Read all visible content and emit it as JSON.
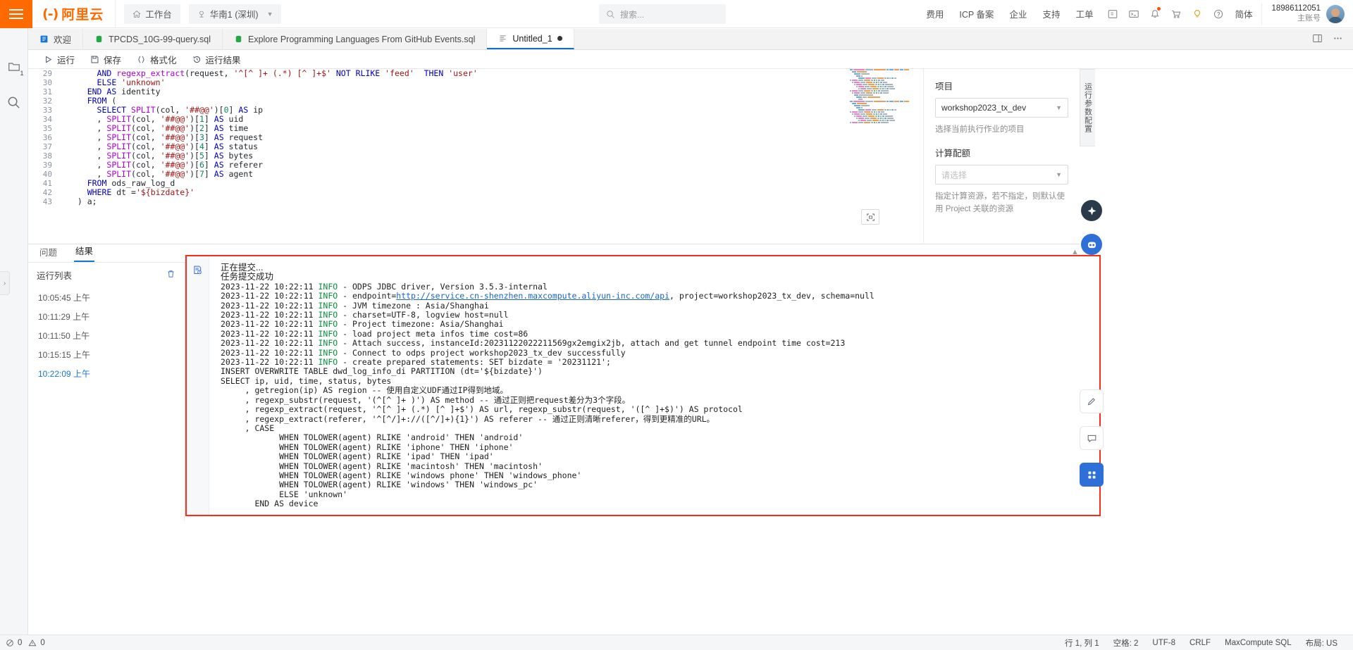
{
  "header": {
    "logo_text": "阿里云",
    "workbench": "工作台",
    "region": "华南1 (深圳)",
    "search_placeholder": "搜索...",
    "links": [
      "费用",
      "ICP 备案",
      "企业",
      "支持",
      "工单"
    ],
    "icons": [
      "app-switch-icon",
      "terminal-icon",
      "bell-icon",
      "cart-icon",
      "bulb-icon",
      "help-icon"
    ],
    "lang": "简体",
    "user_id": "18986112051",
    "user_role": "主账号"
  },
  "left_rail": {
    "items": [
      "folder-icon",
      "search-icon"
    ],
    "folder_badge": "1"
  },
  "tabs": [
    {
      "label": "欢迎",
      "icon": "welcome-icon",
      "active": false,
      "dirty": false
    },
    {
      "label": "TPCDS_10G-99-query.sql",
      "icon": "sql-file-icon",
      "active": false,
      "dirty": false
    },
    {
      "label": "Explore Programming Languages From GitHub Events.sql",
      "icon": "sql-file-icon",
      "active": false,
      "dirty": false
    },
    {
      "label": "Untitled_1",
      "icon": "sql-doc-icon",
      "active": true,
      "dirty": true
    }
  ],
  "toolbar": [
    {
      "label": "运行",
      "icon": "play-icon"
    },
    {
      "label": "保存",
      "icon": "save-icon"
    },
    {
      "label": "格式化",
      "icon": "braces-icon"
    },
    {
      "label": "运行结果",
      "icon": "history-icon"
    }
  ],
  "editor": {
    "zoom_icon": "fit-screen-icon",
    "lines": [
      {
        "no": 29,
        "tokens": [
          {
            "t": "      ",
            "c": "pl"
          },
          {
            "t": "AND",
            "c": "k"
          },
          {
            "t": " ",
            "c": "pl"
          },
          {
            "t": "regexp_extract",
            "c": "kp"
          },
          {
            "t": "(request, ",
            "c": "pl"
          },
          {
            "t": "'^[^ ]+ (.*) [^ ]+$'",
            "c": "s"
          },
          {
            "t": " ",
            "c": "pl"
          },
          {
            "t": "NOT",
            "c": "k"
          },
          {
            "t": " ",
            "c": "pl"
          },
          {
            "t": "RLIKE",
            "c": "k"
          },
          {
            "t": " ",
            "c": "pl"
          },
          {
            "t": "'feed'",
            "c": "s"
          },
          {
            "t": "  ",
            "c": "pl"
          },
          {
            "t": "THEN",
            "c": "k"
          },
          {
            "t": " ",
            "c": "pl"
          },
          {
            "t": "'user'",
            "c": "s"
          }
        ]
      },
      {
        "no": 30,
        "tokens": [
          {
            "t": "      ",
            "c": "pl"
          },
          {
            "t": "ELSE",
            "c": "k"
          },
          {
            "t": " ",
            "c": "pl"
          },
          {
            "t": "'unknown'",
            "c": "s"
          }
        ]
      },
      {
        "no": 31,
        "tokens": [
          {
            "t": "    ",
            "c": "pl"
          },
          {
            "t": "END AS",
            "c": "k"
          },
          {
            "t": " identity",
            "c": "pl"
          }
        ]
      },
      {
        "no": 32,
        "tokens": [
          {
            "t": "    ",
            "c": "pl"
          },
          {
            "t": "FROM",
            "c": "k"
          },
          {
            "t": " (",
            "c": "pl"
          }
        ]
      },
      {
        "no": 33,
        "tokens": [
          {
            "t": "      ",
            "c": "pl"
          },
          {
            "t": "SELECT",
            "c": "k"
          },
          {
            "t": " ",
            "c": "pl"
          },
          {
            "t": "SPLIT",
            "c": "kp"
          },
          {
            "t": "(col, ",
            "c": "pl"
          },
          {
            "t": "'##@@'",
            "c": "s"
          },
          {
            "t": ")[",
            "c": "pl"
          },
          {
            "t": "0",
            "c": "n"
          },
          {
            "t": "] ",
            "c": "pl"
          },
          {
            "t": "AS",
            "c": "k"
          },
          {
            "t": " ip",
            "c": "pl"
          }
        ]
      },
      {
        "no": 34,
        "tokens": [
          {
            "t": "      , ",
            "c": "pl"
          },
          {
            "t": "SPLIT",
            "c": "kp"
          },
          {
            "t": "(col, ",
            "c": "pl"
          },
          {
            "t": "'##@@'",
            "c": "s"
          },
          {
            "t": ")[",
            "c": "pl"
          },
          {
            "t": "1",
            "c": "n"
          },
          {
            "t": "] ",
            "c": "pl"
          },
          {
            "t": "AS",
            "c": "k"
          },
          {
            "t": " uid",
            "c": "pl"
          }
        ]
      },
      {
        "no": 35,
        "tokens": [
          {
            "t": "      , ",
            "c": "pl"
          },
          {
            "t": "SPLIT",
            "c": "kp"
          },
          {
            "t": "(col, ",
            "c": "pl"
          },
          {
            "t": "'##@@'",
            "c": "s"
          },
          {
            "t": ")[",
            "c": "pl"
          },
          {
            "t": "2",
            "c": "n"
          },
          {
            "t": "] ",
            "c": "pl"
          },
          {
            "t": "AS",
            "c": "k"
          },
          {
            "t": " time",
            "c": "pl"
          }
        ]
      },
      {
        "no": 36,
        "tokens": [
          {
            "t": "      , ",
            "c": "pl"
          },
          {
            "t": "SPLIT",
            "c": "kp"
          },
          {
            "t": "(col, ",
            "c": "pl"
          },
          {
            "t": "'##@@'",
            "c": "s"
          },
          {
            "t": ")[",
            "c": "pl"
          },
          {
            "t": "3",
            "c": "n"
          },
          {
            "t": "] ",
            "c": "pl"
          },
          {
            "t": "AS",
            "c": "k"
          },
          {
            "t": " request",
            "c": "pl"
          }
        ]
      },
      {
        "no": 37,
        "tokens": [
          {
            "t": "      , ",
            "c": "pl"
          },
          {
            "t": "SPLIT",
            "c": "kp"
          },
          {
            "t": "(col, ",
            "c": "pl"
          },
          {
            "t": "'##@@'",
            "c": "s"
          },
          {
            "t": ")[",
            "c": "pl"
          },
          {
            "t": "4",
            "c": "n"
          },
          {
            "t": "] ",
            "c": "pl"
          },
          {
            "t": "AS",
            "c": "k"
          },
          {
            "t": " status",
            "c": "pl"
          }
        ]
      },
      {
        "no": 38,
        "tokens": [
          {
            "t": "      , ",
            "c": "pl"
          },
          {
            "t": "SPLIT",
            "c": "kp"
          },
          {
            "t": "(col, ",
            "c": "pl"
          },
          {
            "t": "'##@@'",
            "c": "s"
          },
          {
            "t": ")[",
            "c": "pl"
          },
          {
            "t": "5",
            "c": "n"
          },
          {
            "t": "] ",
            "c": "pl"
          },
          {
            "t": "AS",
            "c": "k"
          },
          {
            "t": " bytes",
            "c": "pl"
          }
        ]
      },
      {
        "no": 39,
        "tokens": [
          {
            "t": "      , ",
            "c": "pl"
          },
          {
            "t": "SPLIT",
            "c": "kp"
          },
          {
            "t": "(col, ",
            "c": "pl"
          },
          {
            "t": "'##@@'",
            "c": "s"
          },
          {
            "t": ")[",
            "c": "pl"
          },
          {
            "t": "6",
            "c": "n"
          },
          {
            "t": "] ",
            "c": "pl"
          },
          {
            "t": "AS",
            "c": "k"
          },
          {
            "t": " referer",
            "c": "pl"
          }
        ]
      },
      {
        "no": 40,
        "tokens": [
          {
            "t": "      , ",
            "c": "pl"
          },
          {
            "t": "SPLIT",
            "c": "kp"
          },
          {
            "t": "(col, ",
            "c": "pl"
          },
          {
            "t": "'##@@'",
            "c": "s"
          },
          {
            "t": ")[",
            "c": "pl"
          },
          {
            "t": "7",
            "c": "n"
          },
          {
            "t": "] ",
            "c": "pl"
          },
          {
            "t": "AS",
            "c": "k"
          },
          {
            "t": " agent",
            "c": "pl"
          }
        ]
      },
      {
        "no": 41,
        "tokens": [
          {
            "t": "    ",
            "c": "pl"
          },
          {
            "t": "FROM",
            "c": "k"
          },
          {
            "t": " ods_raw_log_d",
            "c": "pl"
          }
        ]
      },
      {
        "no": 42,
        "tokens": [
          {
            "t": "    ",
            "c": "pl"
          },
          {
            "t": "WHERE",
            "c": "k"
          },
          {
            "t": " dt =",
            "c": "pl"
          },
          {
            "t": "'${bizdate}'",
            "c": "s"
          }
        ]
      },
      {
        "no": 43,
        "tokens": [
          {
            "t": "  ) a;",
            "c": "pl"
          }
        ]
      }
    ]
  },
  "right_panel": {
    "tab_label": "运行参数配置",
    "project_label": "项目",
    "project_value": "workshop2023_tx_dev",
    "project_hint": "选择当前执行作业的项目",
    "quota_label": "计算配额",
    "quota_placeholder": "请选择",
    "quota_hint": "指定计算资源，若不指定，则默认使用 Project 关联的资源"
  },
  "results": {
    "tabs": [
      {
        "label": "问题",
        "active": false
      },
      {
        "label": "结果",
        "active": true
      }
    ],
    "runlist_title": "运行列表",
    "delete_icon": "trash-icon",
    "runs": [
      {
        "time": "10:05:45 上午",
        "active": false
      },
      {
        "time": "10:11:29 上午",
        "active": false
      },
      {
        "time": "10:11:50 上午",
        "active": false
      },
      {
        "time": "10:15:15 上午",
        "active": false
      },
      {
        "time": "10:22:09 上午",
        "active": true
      }
    ],
    "log_icon": "log-doc-icon",
    "log_lines": [
      [
        {
          "t": "正在提交...",
          "c": "log-cn"
        }
      ],
      [
        {
          "t": "任务提交成功",
          "c": "log-cn"
        }
      ],
      [
        {
          "t": "2023-11-22 10:22:11 ",
          "c": ""
        },
        {
          "t": "INFO",
          "c": "lg-info"
        },
        {
          "t": " - ODPS JDBC driver, Version 3.5.3-internal",
          "c": ""
        }
      ],
      [
        {
          "t": "2023-11-22 10:22:11 ",
          "c": ""
        },
        {
          "t": "INFO",
          "c": "lg-info"
        },
        {
          "t": " - endpoint=",
          "c": ""
        },
        {
          "t": "http://service.cn-shenzhen.maxcompute.aliyun-inc.com/api",
          "c": "lg-link"
        },
        {
          "t": ", project=workshop2023_tx_dev, schema=null",
          "c": ""
        }
      ],
      [
        {
          "t": "2023-11-22 10:22:11 ",
          "c": ""
        },
        {
          "t": "INFO",
          "c": "lg-info"
        },
        {
          "t": " - JVM timezone : Asia/Shanghai",
          "c": ""
        }
      ],
      [
        {
          "t": "2023-11-22 10:22:11 ",
          "c": ""
        },
        {
          "t": "INFO",
          "c": "lg-info"
        },
        {
          "t": " - charset=UTF-8, logview host=null",
          "c": ""
        }
      ],
      [
        {
          "t": "2023-11-22 10:22:11 ",
          "c": ""
        },
        {
          "t": "INFO",
          "c": "lg-info"
        },
        {
          "t": " - Project timezone: Asia/Shanghai",
          "c": ""
        }
      ],
      [
        {
          "t": "2023-11-22 10:22:11 ",
          "c": ""
        },
        {
          "t": "INFO",
          "c": "lg-info"
        },
        {
          "t": " - load project meta infos time cost=86",
          "c": ""
        }
      ],
      [
        {
          "t": "2023-11-22 10:22:11 ",
          "c": ""
        },
        {
          "t": "INFO",
          "c": "lg-info"
        },
        {
          "t": " - Attach success, instanceId:20231122022211569gx2emgix2jb, attach and get tunnel endpoint time cost=213",
          "c": ""
        }
      ],
      [
        {
          "t": "2023-11-22 10:22:11 ",
          "c": ""
        },
        {
          "t": "INFO",
          "c": "lg-info"
        },
        {
          "t": " - Connect to odps project workshop2023_tx_dev successfully",
          "c": ""
        }
      ],
      [
        {
          "t": "2023-11-22 10:22:11 ",
          "c": ""
        },
        {
          "t": "INFO",
          "c": "lg-info"
        },
        {
          "t": " - create prepared statements: SET bizdate = '20231121';",
          "c": ""
        }
      ],
      [
        {
          "t": "INSERT OVERWRITE TABLE dwd_log_info_di PARTITION (dt='${bizdate}')",
          "c": ""
        }
      ],
      [
        {
          "t": "SELECT ip, uid, time, status, bytes",
          "c": ""
        }
      ],
      [
        {
          "t": "     , getregion(ip) AS region -- 使用自定义UDF通过IP得到地域。",
          "c": ""
        }
      ],
      [
        {
          "t": "     , regexp_substr(request, '(^[^ ]+ )') AS method -- 通过正则把request差分为3个字段。",
          "c": ""
        }
      ],
      [
        {
          "t": "     , regexp_extract(request, '^[^ ]+ (.*) [^ ]+$') AS url, regexp_substr(request, '([^ ]+$)') AS protocol",
          "c": ""
        }
      ],
      [
        {
          "t": "     , regexp_extract(referer, '^[^/]+://([^/]+){1}') AS referer -- 通过正则清晰referer，得到更精准的URL。",
          "c": ""
        }
      ],
      [
        {
          "t": "     , CASE",
          "c": ""
        }
      ],
      [
        {
          "t": "            WHEN TOLOWER(agent) RLIKE 'android' THEN 'android'",
          "c": ""
        }
      ],
      [
        {
          "t": "            WHEN TOLOWER(agent) RLIKE 'iphone' THEN 'iphone'",
          "c": ""
        }
      ],
      [
        {
          "t": "            WHEN TOLOWER(agent) RLIKE 'ipad' THEN 'ipad'",
          "c": ""
        }
      ],
      [
        {
          "t": "            WHEN TOLOWER(agent) RLIKE 'macintosh' THEN 'macintosh'",
          "c": ""
        }
      ],
      [
        {
          "t": "            WHEN TOLOWER(agent) RLIKE 'windows phone' THEN 'windows_phone'",
          "c": ""
        }
      ],
      [
        {
          "t": "            WHEN TOLOWER(agent) RLIKE 'windows' THEN 'windows_pc'",
          "c": ""
        }
      ],
      [
        {
          "t": "            ELSE 'unknown'",
          "c": ""
        }
      ],
      [
        {
          "t": "       END AS device",
          "c": ""
        }
      ]
    ]
  },
  "side_actions": {
    "ai_icon": "ai-assistant-icon",
    "robot_icon": "robot-icon",
    "edit_icon": "pencil-icon",
    "comment_icon": "comment-icon",
    "apps_icon": "apps-grid-icon"
  },
  "statusbar": {
    "error_icon": "error-circle-icon",
    "error_count": "0",
    "warn_icon": "warning-triangle-icon",
    "warn_count": "0",
    "cursor": "行 1, 列 1",
    "spaces": "空格: 2",
    "encoding": "UTF-8",
    "eol": "CRLF",
    "language": "MaxCompute SQL",
    "layout": "布局: US"
  }
}
